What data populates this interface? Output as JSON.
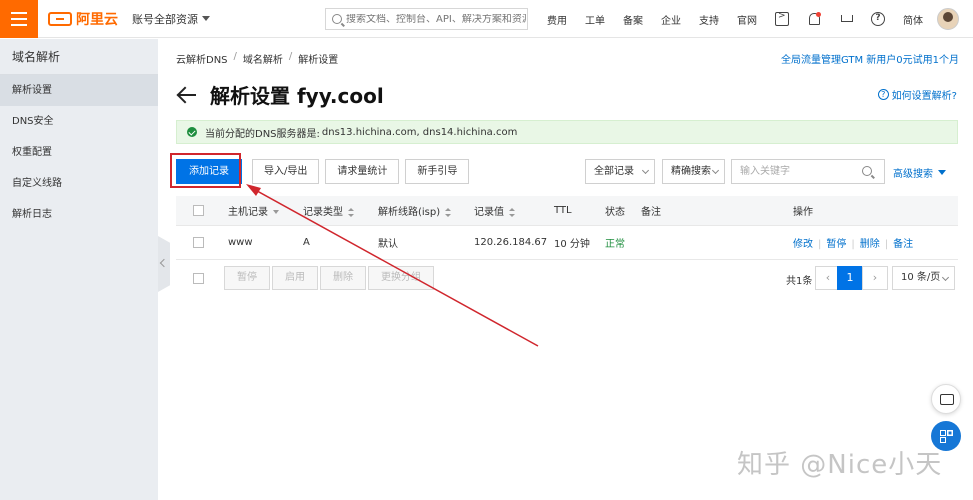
{
  "topbar": {
    "brand": "阿里云",
    "account": "账号全部资源",
    "search_placeholder": "搜索文档、控制台、API、解决方案和资源",
    "links": [
      "费用",
      "工单",
      "备案",
      "企业",
      "支持",
      "官网"
    ],
    "lang": "简体",
    "icons": [
      "terminal-icon",
      "bell-icon",
      "cart-icon",
      "help-icon"
    ]
  },
  "sidebar": {
    "title": "域名解析",
    "items": [
      {
        "label": "解析设置",
        "active": true
      },
      {
        "label": "DNS安全",
        "active": false
      },
      {
        "label": "权重配置",
        "active": false
      },
      {
        "label": "自定义线路",
        "active": false
      },
      {
        "label": "解析日志",
        "active": false
      }
    ]
  },
  "breadcrumb": [
    "云解析DNS",
    "域名解析",
    "解析设置"
  ],
  "promo": "全局流量管理GTM 新用户0元试用1个月",
  "page_title": "解析设置 fyy.cool",
  "howto": "如何设置解析?",
  "dns_banner": {
    "label": "当前分配的DNS服务器是:",
    "servers": "dns13.hichina.com, dns14.hichina.com"
  },
  "toolbar": {
    "add": "添加记录",
    "import_export": "导入/导出",
    "stats": "请求量统计",
    "guide": "新手引导"
  },
  "filters": {
    "all_records": "全部记录",
    "exact_search": "精确搜索",
    "keyword_placeholder": "输入关键字",
    "advanced": "高级搜索"
  },
  "table": {
    "headers": {
      "host": "主机记录",
      "type": "记录类型",
      "line": "解析线路(isp)",
      "value": "记录值",
      "ttl": "TTL",
      "status": "状态",
      "remark": "备注",
      "ops": "操作"
    },
    "rows": [
      {
        "host": "www",
        "type": "A",
        "line": "默认",
        "value": "120.26.184.67",
        "ttl": "10 分钟",
        "status": "正常",
        "remark": "",
        "ops": [
          "修改",
          "暂停",
          "删除",
          "备注"
        ]
      }
    ]
  },
  "bulk": {
    "pause": "暂停",
    "enable": "启用",
    "delete": "删除",
    "change_group": "更换分组"
  },
  "pagination": {
    "total": "共1条",
    "current": "1",
    "page_size": "10 条/页"
  },
  "watermark": "知乎 @Nice小天",
  "colors": {
    "brand": "#ff6a00",
    "primary": "#0073e6",
    "annotation": "#d0262d",
    "success": "#1e8e3e"
  }
}
